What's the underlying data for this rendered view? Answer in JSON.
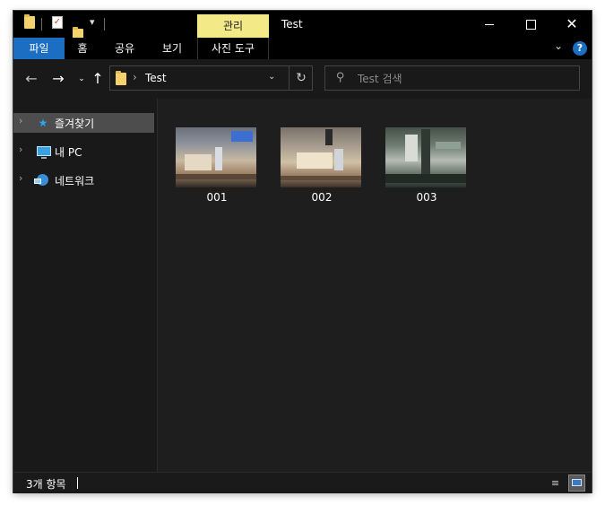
{
  "window": {
    "title": "Test",
    "context_tab": "관리",
    "controls": {
      "minimize": "minimize",
      "maximize": "maximize",
      "close": "✕"
    }
  },
  "quick_access": {
    "dropdown": "▾"
  },
  "ribbon": {
    "tabs": [
      "파일",
      "홈",
      "공유",
      "보기",
      "사진 도구"
    ],
    "expand": "⌄",
    "help": "?"
  },
  "nav": {
    "back": "←",
    "forward": "→",
    "recent": "⌄",
    "up": "↑",
    "address": {
      "separator": "›",
      "path": "Test",
      "dropdown": "⌄",
      "refresh": "↻"
    },
    "search": {
      "placeholder": "Test 검색",
      "icon": "⚲"
    }
  },
  "nav_pane": {
    "items": [
      {
        "label": "즐겨찾기",
        "icon": "star-icon",
        "selected": true,
        "chevron": "›"
      },
      {
        "label": "내 PC",
        "icon": "pc-icon",
        "selected": false,
        "chevron": "›"
      },
      {
        "label": "네트워크",
        "icon": "network-icon",
        "selected": false,
        "chevron": "›"
      }
    ]
  },
  "files": [
    {
      "name": "001"
    },
    {
      "name": "002"
    },
    {
      "name": "003"
    }
  ],
  "status_bar": {
    "count_text": "3개 항목",
    "details_view": "≡"
  },
  "colors": {
    "accent": "#1b6ec2",
    "context_tab_bg": "#f3ea87",
    "window_bg": "#1e1e1e"
  }
}
